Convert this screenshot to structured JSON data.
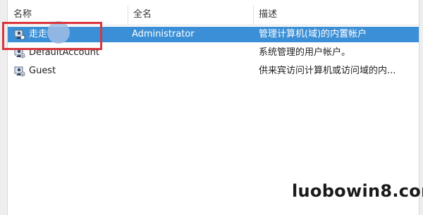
{
  "columns": {
    "name": "名称",
    "full_name": "全名",
    "description": "描述"
  },
  "users": [
    {
      "name": "走走",
      "full_name": "Administrator",
      "description": "管理计算机(域)的内置帐户",
      "selected": true
    },
    {
      "name": "DefaultAccount",
      "full_name": "",
      "description": "系统管理的用户帐户。",
      "selected": false
    },
    {
      "name": "Guest",
      "full_name": "",
      "description": "供来宾访问计算机或访问域的内...",
      "selected": false
    }
  ],
  "icon": "user-account-icon",
  "colors": {
    "selection": "#3b8fd6",
    "highlight_box": "#d9363e"
  },
  "watermark": "luobowin8.com"
}
